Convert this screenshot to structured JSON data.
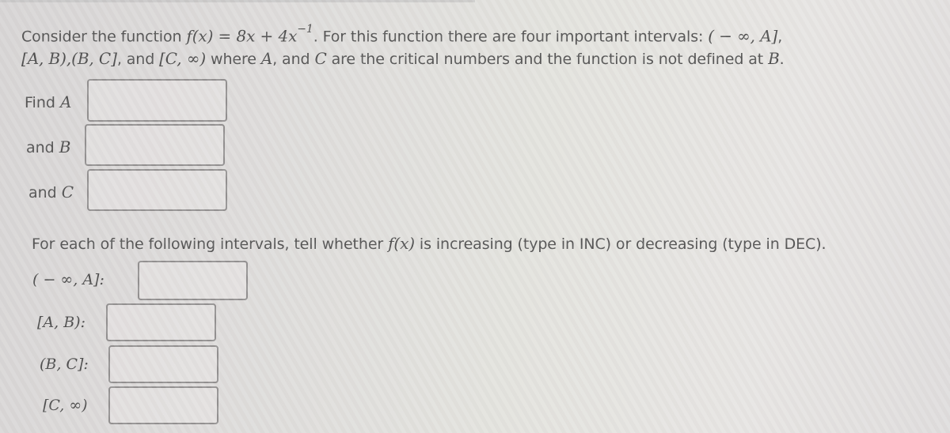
{
  "question": {
    "line1_prefix": "Consider the function ",
    "func_lhs": "f(x)",
    "equals": " = ",
    "func_rhs": "8x + 4x",
    "exponent": "−1",
    "line1_suffix": ". For this function there are four important intervals: ",
    "interval_1": "( − ∞, A]",
    "comma": ",",
    "line2_intervals": "[A, B),(B, C]",
    "line2_and": ", and ",
    "interval_4": "[C, ∞)",
    "line2_where": " where ",
    "var_A": "A",
    "line2_and2": ", and ",
    "var_C": "C",
    "line2_suffix": " are the critical numbers and the function is not defined at ",
    "var_B": "B",
    "period": "."
  },
  "critical_inputs": [
    {
      "label_text": "Find ",
      "label_var": "A",
      "value": ""
    },
    {
      "label_text": "and ",
      "label_var": "B",
      "value": ""
    },
    {
      "label_text": "and ",
      "label_var": "C",
      "value": ""
    }
  ],
  "instruction": {
    "prefix": "For each of the following intervals, tell whether ",
    "func": "f(x)",
    "suffix": " is increasing (type in INC) or decreasing (type in DEC)."
  },
  "interval_inputs": [
    {
      "label": "( − ∞, A]:",
      "value": ""
    },
    {
      "label": "[A, B):",
      "value": ""
    },
    {
      "label": "(B, C]:",
      "value": ""
    },
    {
      "label": "[C, ∞)",
      "value": ""
    }
  ]
}
